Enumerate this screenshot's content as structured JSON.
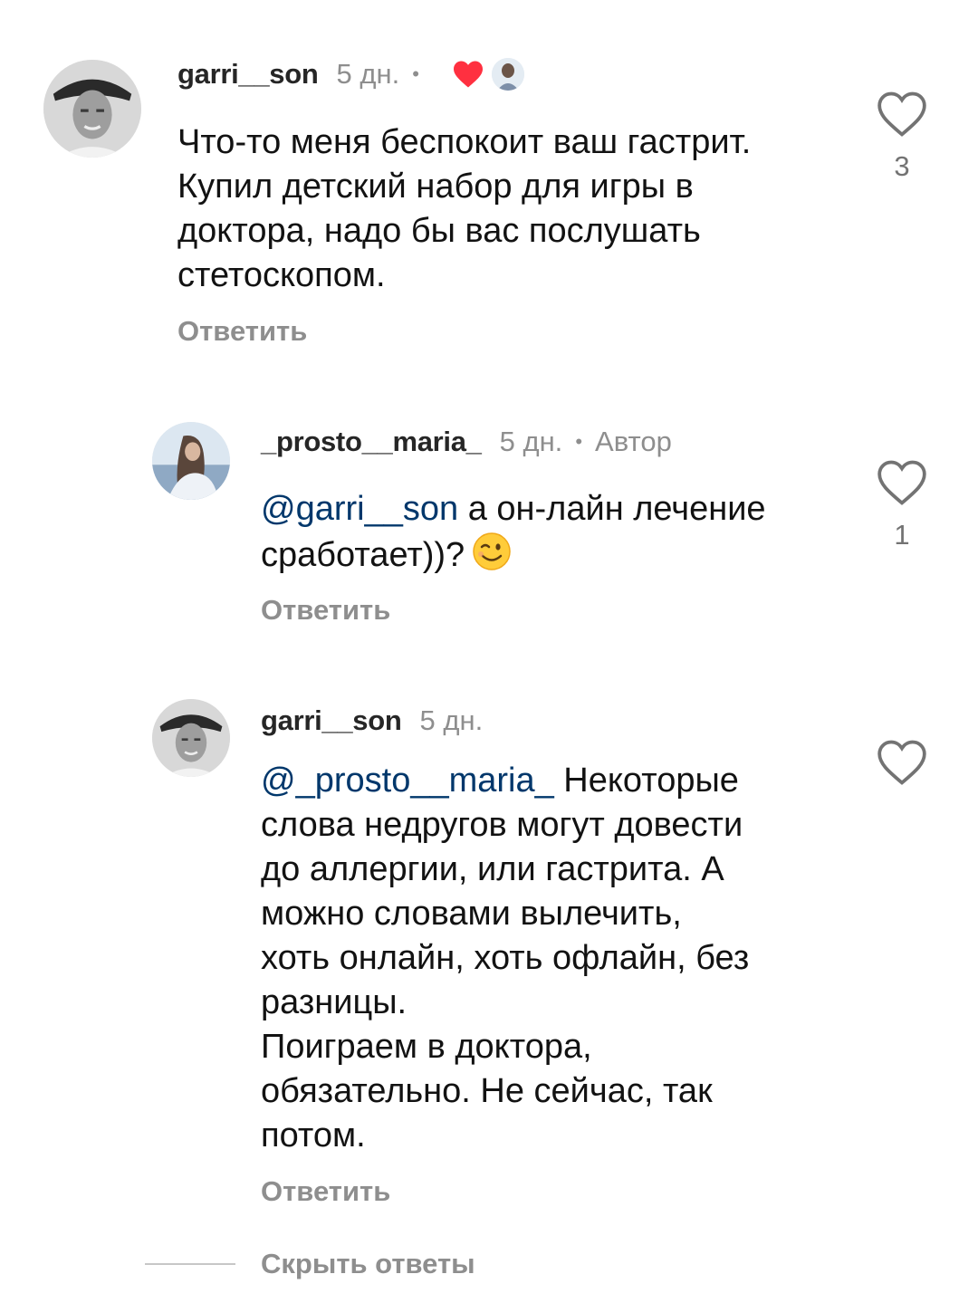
{
  "comments": [
    {
      "username": "garri__son",
      "time": "5 дн.",
      "dot": "•",
      "liked_by_author_icon": "heart-filled-icon",
      "text": "Что-то меня беспокоит ваш гастрит.\nКупил детский набор для игры в\nдоктора, надо бы вас послушать\nстетоскопом.",
      "reply_label": "Ответить",
      "like_count": "3"
    },
    {
      "username": "_prosto__maria_",
      "time": "5 дн.",
      "dot": "•",
      "author_label": "Автор",
      "mention": "@garri__son",
      "text": " а он-лайн лечение\nсработает))?",
      "emoji": "winking-face-emoji",
      "reply_label": "Ответить",
      "like_count": "1"
    },
    {
      "username": "garri__son",
      "time": "5 дн.",
      "mention": "@_prosto__maria_",
      "text": " Некоторые\nслова недругов могут довести\nдо аллергии, или гастрита. А\nможно словами вылечить,\nхоть онлайн, хоть офлайн, без\nразницы.\nПоиграем в доктора,\nобязательно. Не сейчас, так\nпотом.",
      "reply_label": "Ответить"
    }
  ],
  "hide_replies_label": "Скрыть ответы",
  "colors": {
    "mention": "#00376b",
    "secondary_text": "#8e8e8e",
    "heart_red": "#ff3040"
  }
}
